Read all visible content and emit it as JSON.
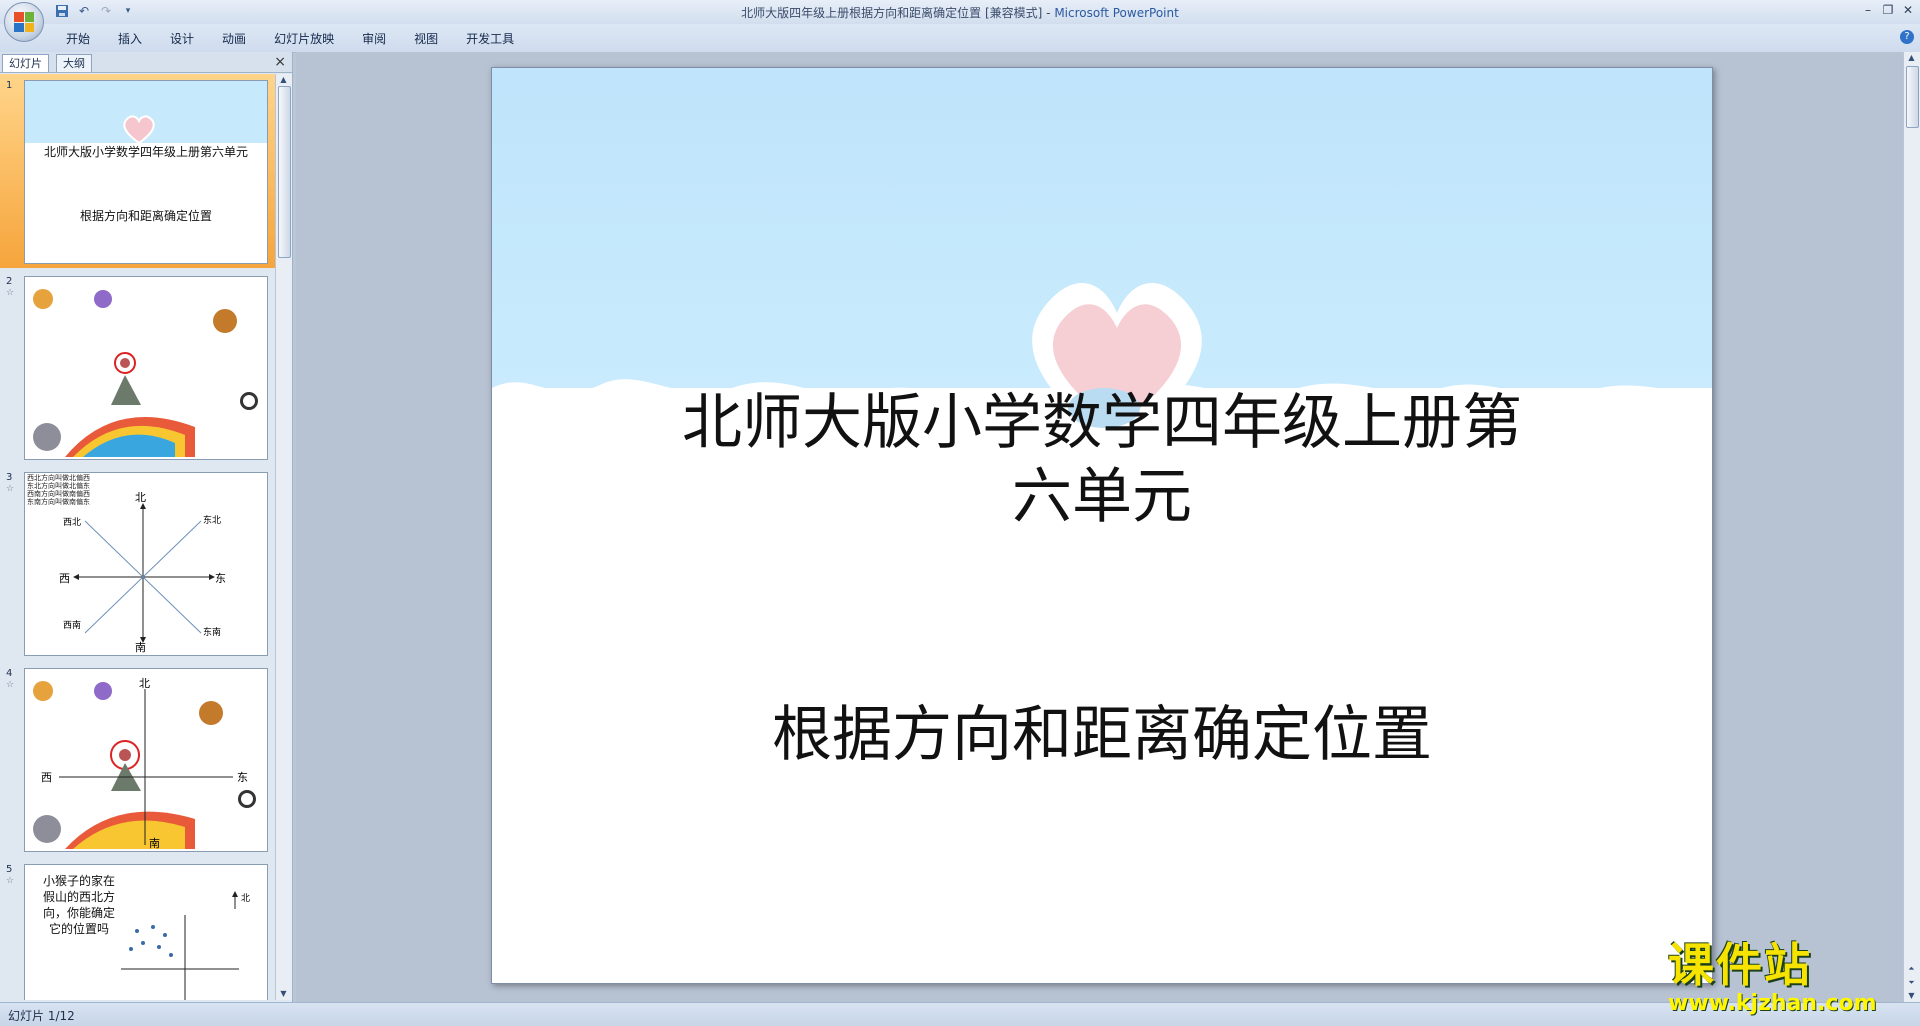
{
  "window": {
    "title_doc": "北师大版四年级上册根据方向和距离确定位置 [兼容模式] - ",
    "title_app": "Microsoft PowerPoint"
  },
  "ribbon": {
    "tabs": [
      "开始",
      "插入",
      "设计",
      "动画",
      "幻灯片放映",
      "审阅",
      "视图",
      "开发工具"
    ]
  },
  "panel": {
    "tabs": [
      "幻灯片",
      "大纲"
    ],
    "close": "×"
  },
  "thumbnails": [
    {
      "num": "1",
      "title": "北师大版小学数学四年级上册第六单元",
      "subtitle": "根据方向和距离确定位置"
    },
    {
      "num": "2"
    },
    {
      "num": "3",
      "labels": [
        "北",
        "南",
        "东",
        "西",
        "东北",
        "西北",
        "东南",
        "西南"
      ],
      "note": "西北方向叫做北偏西\n东北方向叫做北偏东\n西南方向叫做南偏西\n东南方向叫做南偏东"
    },
    {
      "num": "4",
      "labels": [
        "北",
        "南",
        "东",
        "西"
      ]
    },
    {
      "num": "5",
      "text": "小猴子的家在假山的西北方向，你能确定它的位置吗",
      "label": "北"
    }
  ],
  "slide": {
    "title_line1": "北师大版小学数学四年级上册第",
    "title_line2": "六单元",
    "subtitle": "根据方向和距离确定位置"
  },
  "status": {
    "text": "幻灯片 1/12"
  },
  "watermark": {
    "cn": "课件站",
    "url": "www.kjzhan.com"
  },
  "colors": {
    "sky": "#c5e8fc",
    "selected": "#f6a53c",
    "watermark": "#f7e300"
  }
}
